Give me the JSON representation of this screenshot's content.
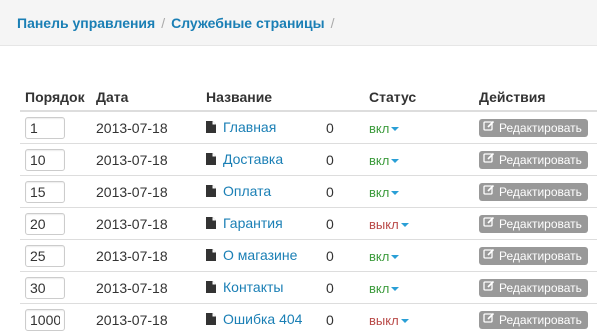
{
  "breadcrumb": {
    "items": [
      "Панель управления",
      "Служебные страницы"
    ],
    "separator": "/"
  },
  "table": {
    "headers": {
      "order": "Порядок",
      "date": "Дата",
      "name": "Название",
      "count": "",
      "status": "Статус",
      "actions": "Действия"
    },
    "rows": [
      {
        "order": "1",
        "date": "2013-07-18",
        "name": "Главная",
        "count": "0",
        "status": "вкл",
        "status_color": "#3c9b3c",
        "action": "Редактировать"
      },
      {
        "order": "10",
        "date": "2013-07-18",
        "name": "Доставка",
        "count": "0",
        "status": "вкл",
        "status_color": "#3c9b3c",
        "action": "Редактировать"
      },
      {
        "order": "15",
        "date": "2013-07-18",
        "name": "Оплата",
        "count": "0",
        "status": "вкл",
        "status_color": "#3c9b3c",
        "action": "Редактировать"
      },
      {
        "order": "20",
        "date": "2013-07-18",
        "name": "Гарантия",
        "count": "0",
        "status": "выкл",
        "status_color": "#b94a48",
        "action": "Редактировать"
      },
      {
        "order": "25",
        "date": "2013-07-18",
        "name": "О магазине",
        "count": "0",
        "status": "вкл",
        "status_color": "#3c9b3c",
        "action": "Редактировать"
      },
      {
        "order": "30",
        "date": "2013-07-18",
        "name": "Контакты",
        "count": "0",
        "status": "вкл",
        "status_color": "#3c9b3c",
        "action": "Редактировать"
      },
      {
        "order": "1000",
        "date": "2013-07-18",
        "name": "Ошибка 404",
        "count": "0",
        "status": "выкл",
        "status_color": "#b94a48",
        "action": "Редактировать"
      }
    ]
  },
  "icons": {
    "page": "file-icon",
    "edit": "edit-icon",
    "status_dropdown": "caret-down-icon"
  },
  "colors": {
    "link": "#1a7fb5",
    "button": "#999999",
    "caret": "#2a9fd6"
  }
}
